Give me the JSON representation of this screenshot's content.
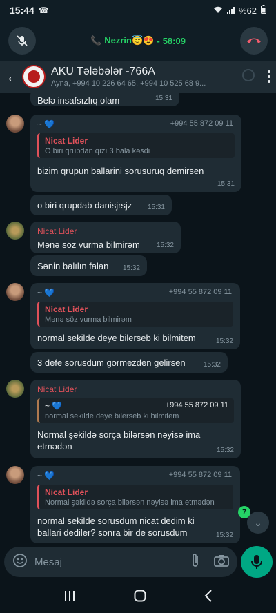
{
  "status_bar": {
    "time": "15:44",
    "battery": "%62"
  },
  "call_bar": {
    "caller": "Nezrin😇😍",
    "separator": "-",
    "duration": "58:09"
  },
  "header": {
    "title": "AKU Tələbələr -766A",
    "subtitle": "Ayna, +994 10 226 64 65, +994 10 525 68 9..."
  },
  "messages": [
    {
      "type": "continuation",
      "text": "Belə insafsızlıq olam",
      "time": "15:31"
    },
    {
      "sender": "~ 💙",
      "phone": "+994 55 872 09 11",
      "quote": {
        "name": "Nicat Lider",
        "text": "O biri qrupdan qızı 3 bala kəsdi"
      },
      "text": "bizim qrupun ballarini sorusuruq demirsen",
      "time": "15:31"
    },
    {
      "text": "o biri qrupdab danisjrsjz",
      "time": "15:31"
    },
    {
      "sender": "Nicat Lider",
      "text": "Mənə söz vurma bilmirəm",
      "time": "15:32"
    },
    {
      "text": "Sənin balılın falan",
      "time": "15:32"
    },
    {
      "sender": "~ 💙",
      "phone": "+994 55 872 09 11",
      "quote": {
        "name": "Nicat Lider",
        "text": "Mənə söz vurma bilmirəm"
      },
      "text": "normal sekilde deye bilerseb ki bilmitem",
      "time": "15:32"
    },
    {
      "text": "3 defe sorusdum gormezden gelirsen",
      "time": "15:32"
    },
    {
      "sender": "Nicat Lider",
      "quote": {
        "name": "~ 💙",
        "phone": "+994 55 872 09 11",
        "text": "normal sekilde deye bilerseb ki bilmitem"
      },
      "text_lines": [
        "Normal şəkildə sorça bilərsən nəyisə ima",
        "etmədən"
      ],
      "time": "15:32"
    },
    {
      "sender": "~ 💙",
      "phone": "+994 55 872 09 11",
      "quote": {
        "name": "Nicat Lider",
        "text": "Normal şəkildə sorça bilərsən nəyisə ima etmədən"
      },
      "text_lines": [
        "normal sekilde sorusdum nicat dedim ki",
        "ballari dediler? sonra bir de sorusdum"
      ],
      "time": "15:32"
    }
  ],
  "scroll_badge": "7",
  "input": {
    "placeholder": "Mesaj"
  },
  "colors": {
    "accent": "#25d366",
    "nicat_name": "#e0515a",
    "bubble": "#1f2c34",
    "background": "#0b141a"
  }
}
